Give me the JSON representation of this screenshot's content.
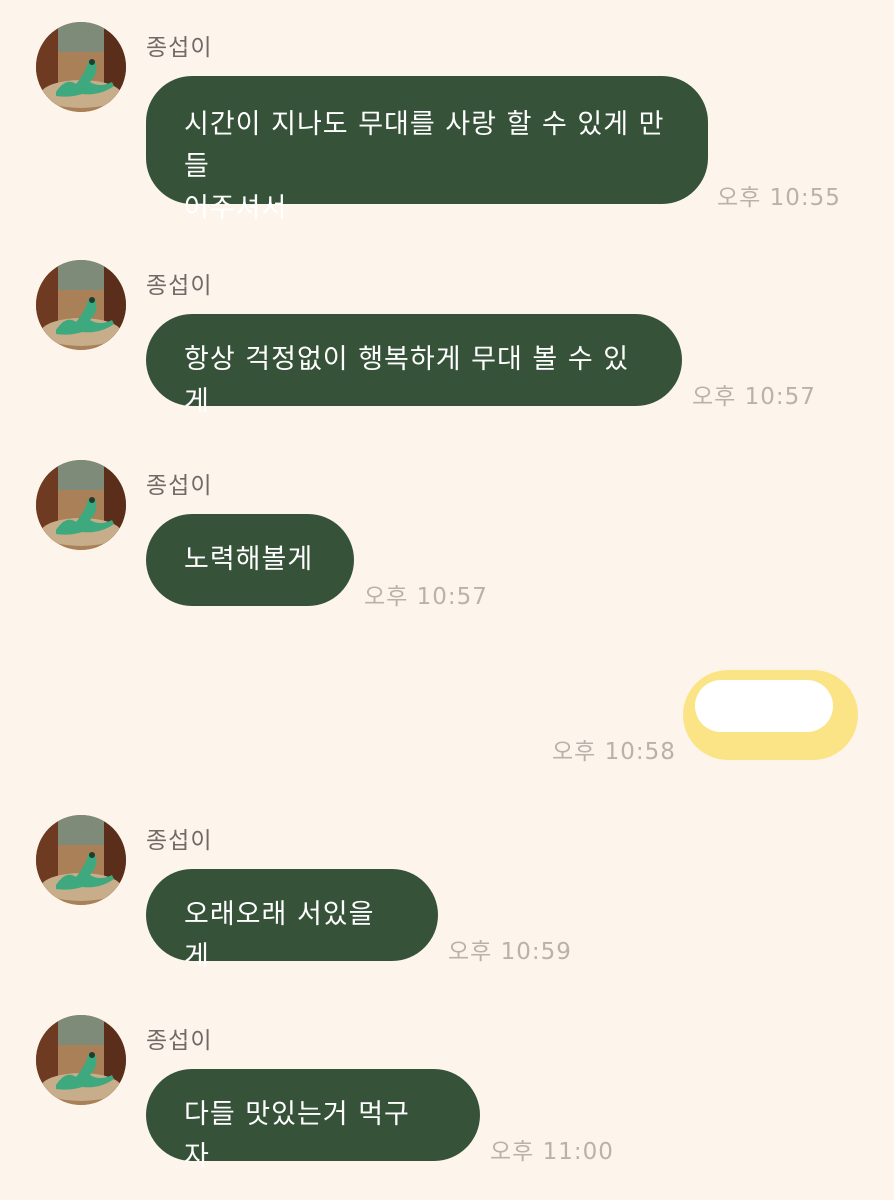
{
  "colors": {
    "background": "#fdf5ec",
    "received_bubble": "#36533a",
    "sent_bubble": "#fbe486",
    "time_text": "#b9b2ab"
  },
  "messages": [
    {
      "sender": "종섭이",
      "text": "시간이 지나도 무대를 사랑 할 수 있게 만들어주셔서",
      "line1": "시간이 지나도 무대를 사랑 할 수 있게 만들",
      "line2": "어주셔서",
      "time": "오후 10:55"
    },
    {
      "sender": "종섭이",
      "text": "항상 걱정없이 행복하게 무대 볼 수 있게",
      "time": "오후 10:57"
    },
    {
      "sender": "종섭이",
      "text": "노력해볼게",
      "time": "오후 10:57"
    },
    {
      "mine": true,
      "text": "",
      "time": "오후 10:58"
    },
    {
      "sender": "종섭이",
      "text": "오래오래 서있을게",
      "time": "오후 10:59"
    },
    {
      "sender": "종섭이",
      "text": "다들 맛있는거 먹구 자",
      "time": "오후 11:00"
    }
  ]
}
